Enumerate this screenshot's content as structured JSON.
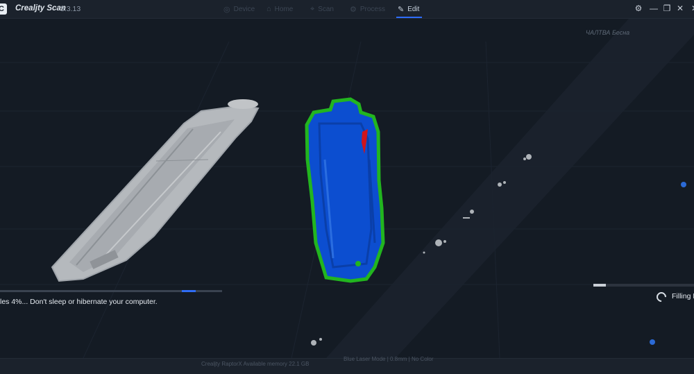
{
  "app": {
    "name": "Crealjty Scan",
    "version": "3.3.13",
    "logo_letter": "C"
  },
  "nav": [
    {
      "label": "Device",
      "icon": "camera-icon",
      "glyph": "◎"
    },
    {
      "label": "Home",
      "icon": "home-icon",
      "glyph": "⌂"
    },
    {
      "label": "Scan",
      "icon": "scan-icon",
      "glyph": "⌖"
    },
    {
      "label": "Process",
      "icon": "process-icon",
      "glyph": "⚙"
    },
    {
      "label": "Edit",
      "icon": "edit-icon",
      "glyph": "✎"
    }
  ],
  "active_nav": "Edit",
  "window_controls": {
    "settings_glyph": "⚙",
    "minimize_glyph": "—",
    "restore_glyph": "❐",
    "close_glyph": "✕"
  },
  "viewport": {
    "axis_label": "ЧАЛТВА  Бесна"
  },
  "progress": {
    "message": "les 4%... Don't sleep or hibernate your computer.",
    "percent": 4,
    "right_label": "Filling H",
    "right_percent": 12
  },
  "bottom": {
    "device_info": "Crealjty RaptorX    Available memory    22.1 GB",
    "mode_info": "Blue Laser Mode  |  0.8mm  |  No Color"
  },
  "colors": {
    "background": "#141b24",
    "accent": "#2e6cff",
    "model_gray": "#b5b9bd",
    "model_blue": "#0c4ed0",
    "outline_green": "#22b51f",
    "selection_red": "#d0141c"
  }
}
